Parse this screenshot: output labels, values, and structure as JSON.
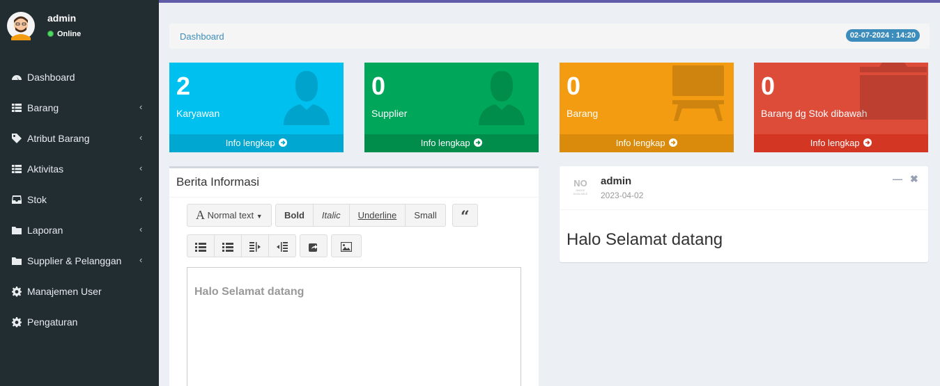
{
  "user": {
    "name": "admin",
    "status": "Online"
  },
  "sidebar": {
    "items": [
      {
        "label": "Dashboard",
        "icon": "dashboard-icon",
        "has_children": false
      },
      {
        "label": "Barang",
        "icon": "table-icon",
        "has_children": true
      },
      {
        "label": "Atribut Barang",
        "icon": "tag-icon",
        "has_children": true
      },
      {
        "label": "Aktivitas",
        "icon": "table-icon",
        "has_children": true
      },
      {
        "label": "Stok",
        "icon": "inbox-icon",
        "has_children": true
      },
      {
        "label": "Laporan",
        "icon": "folder-icon",
        "has_children": true
      },
      {
        "label": "Supplier & Pelanggan",
        "icon": "folder-icon",
        "has_children": true
      },
      {
        "label": "Manajemen User",
        "icon": "gear-icon",
        "has_children": false
      },
      {
        "label": "Pengaturan",
        "icon": "gear-icon",
        "has_children": false
      }
    ]
  },
  "breadcrumb": {
    "text": "Dashboard",
    "datetime": "02-07-2024 : 14:20"
  },
  "stats": [
    {
      "value": "2",
      "label": "Karyawan",
      "link": "Info lengkap",
      "color": "#00c0ef",
      "icon": "user-icon"
    },
    {
      "value": "0",
      "label": "Supplier",
      "link": "Info lengkap",
      "color": "#00a65a",
      "icon": "user-icon"
    },
    {
      "value": "0",
      "label": "Barang",
      "link": "Info lengkap",
      "color": "#f39c12",
      "icon": "desk-icon"
    },
    {
      "value": "0",
      "label": "Barang dg Stok dibawah",
      "link": "Info lengkap",
      "color": "#dd4b39",
      "icon": "archive-icon"
    }
  ],
  "news": {
    "title": "Berita Informasi",
    "toolbar": {
      "normal_text": "Normal text",
      "bold": "Bold",
      "italic": "Italic",
      "underline": "Underline",
      "small": "Small"
    },
    "editor_text": "Halo Selamat datang"
  },
  "post": {
    "image_text": "NO",
    "image_subtext": "IMAGE AVAILABLE",
    "author": "admin",
    "date": "2023-04-02",
    "body": "Halo Selamat datang"
  }
}
